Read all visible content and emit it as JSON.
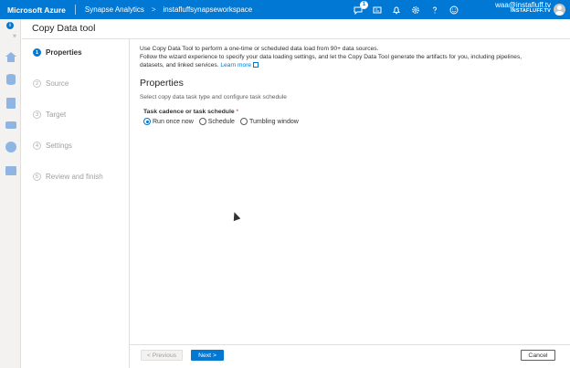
{
  "topbar": {
    "brand": "Microsoft Azure",
    "breadcrumbs": [
      "Synapse Analytics",
      ">",
      "instafluffsynapseworkspace"
    ],
    "notification_count": "1",
    "user_email": "waa@instafluff.tv",
    "user_tenant": "INSTAFLUFF.TV",
    "icons": [
      "feedback-icon",
      "directory-icon",
      "bell-icon",
      "gear-icon",
      "help-icon",
      "smiley-icon"
    ]
  },
  "page": {
    "title": "Copy Data tool"
  },
  "steps": [
    {
      "number": "1",
      "label": "Properties",
      "active": true
    },
    {
      "number": "2",
      "label": "Source",
      "active": false
    },
    {
      "number": "3",
      "label": "Target",
      "active": false
    },
    {
      "number": "4",
      "label": "Settings",
      "active": false
    },
    {
      "number": "5",
      "label": "Review and finish",
      "active": false
    }
  ],
  "main": {
    "intro_line1": "Use Copy Data Tool to perform a one-time or scheduled data load from 90+ data sources.",
    "intro_line2": "Follow the wizard experience to specify your data loading settings, and let the Copy Data Tool generate the artifacts for you, including pipelines,",
    "intro_line3": "datasets, and linked services.",
    "learn_more": "Learn more",
    "section_title": "Properties",
    "subtitle": "Select copy data task type and configure task schedule",
    "field_label": "Task cadence or task schedule",
    "required_mark": "*",
    "radio_options": [
      {
        "label": "Run once now",
        "checked": true
      },
      {
        "label": "Schedule",
        "checked": false
      },
      {
        "label": "Tumbling window",
        "checked": false
      }
    ]
  },
  "footer": {
    "previous_label": "< Previous",
    "next_label": "Next >",
    "cancel_label": "Cancel"
  },
  "colors": {
    "accent": "#0078d4",
    "rail_background": "#f3f2f1"
  }
}
